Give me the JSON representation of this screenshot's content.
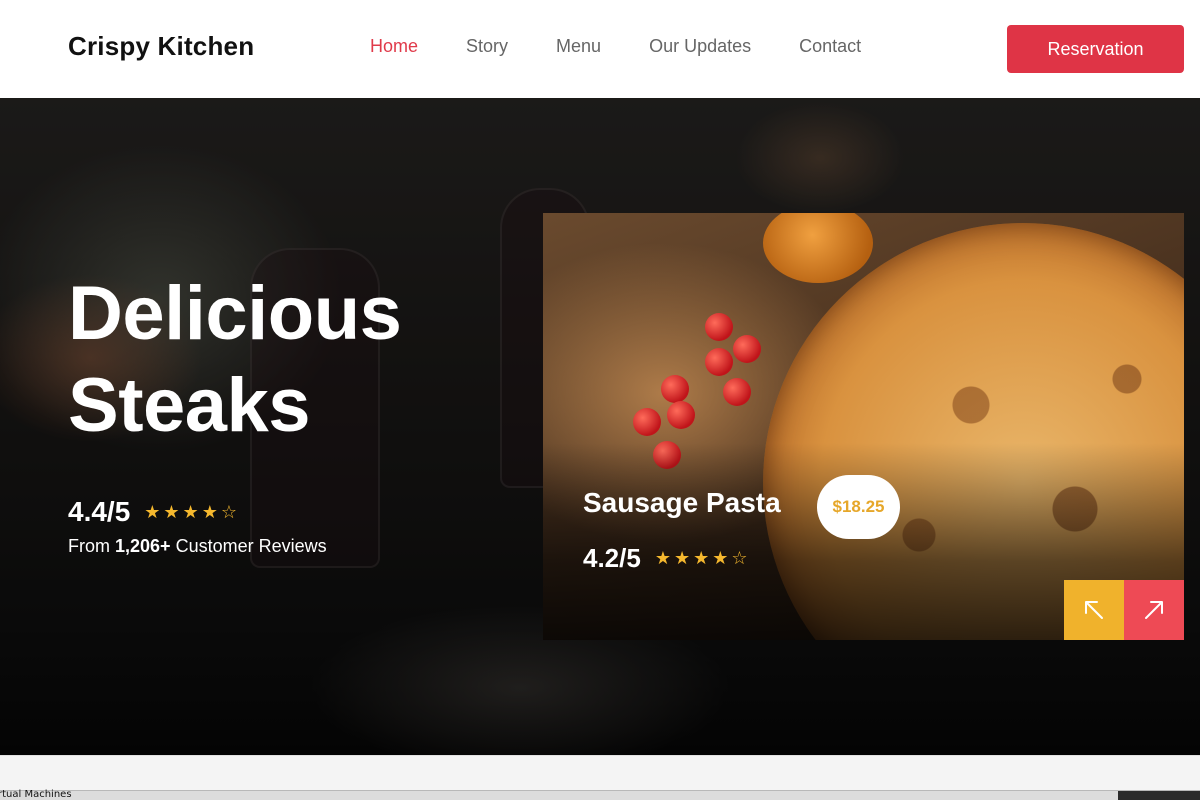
{
  "header": {
    "brand": "Crispy Kitchen",
    "nav": [
      {
        "label": "Home",
        "active": true
      },
      {
        "label": "Story",
        "active": false
      },
      {
        "label": "Menu",
        "active": false
      },
      {
        "label": "Our Updates",
        "active": false
      },
      {
        "label": "Contact",
        "active": false
      }
    ],
    "reservation_label": "Reservation"
  },
  "hero": {
    "title_line1": "Delicious",
    "title_line2": "Steaks",
    "rating": "4.4/5",
    "stars": "★★★★☆",
    "rating_stars_value": 4,
    "reviews_prefix": "From",
    "reviews_count": "1,206+",
    "reviews_suffix": "Customer Reviews"
  },
  "featured_card": {
    "dish_name": "Sausage Pasta",
    "price": "$18.25",
    "rating": "4.2/5",
    "stars": "★★★★☆",
    "rating_stars_value": 4,
    "prev_icon": "arrow-up-left-icon",
    "next_icon": "arrow-up-right-icon"
  },
  "taskbar": {
    "label": "rtual Machines"
  },
  "colors": {
    "accent_red": "#df3446",
    "star_gold": "#f5b82e",
    "prev_button": "#f0b22c",
    "next_button": "#ee4a55",
    "price_text": "#e6a72a"
  }
}
